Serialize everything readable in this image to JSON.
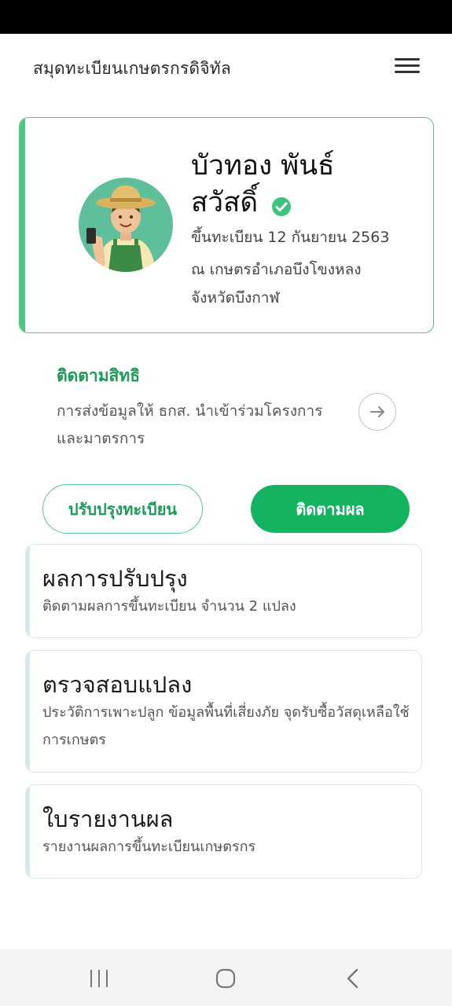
{
  "header": {
    "title": "สมุดทะเบียนเกษตรกรดิจิทัล",
    "menu_icon": "hamburger-menu-icon"
  },
  "profile": {
    "name_line1": "บัวทอง พันธ์",
    "name_line2": "สวัสดิ์",
    "verified_icon": "check-circle-icon",
    "registration_date": "ขึ้นทะเบียน 12 กันยายน 2563",
    "office": "ณ เกษตรอำเภอบึงโขงหลง",
    "province": "จังหวัดบึงกาฬ",
    "accent_color": "#4cc685"
  },
  "rights": {
    "title": "ติดตามสิทธิ",
    "description": "การส่งข้อมูลให้ ธกส. นำเข้าร่วมโครงการและมาตรการ",
    "arrow_icon": "arrow-right-icon"
  },
  "actions": {
    "update_label": "ปรับปรุงทะเบียน",
    "track_label": "ติดตามผล",
    "primary_color": "#14b362"
  },
  "cards": [
    {
      "title": "ผลการปรับปรุง",
      "description": "ติดตามผลการขึ้นทะเบียน จำนวน 2 แปลง"
    },
    {
      "title": "ตรวจสอบแปลง",
      "description": "ประวัติการเพาะปลูก ข้อมูลพื้นที่เสี่ยงภัย จุดรับซื้อวัสดุเหลือใช้การเกษตร"
    },
    {
      "title": "ใบรายงานผล",
      "description": "รายงานผลการขึ้นทะเบียนเกษตรกร"
    }
  ],
  "system_nav": {
    "recent_icon": "recent-apps-icon",
    "home_icon": "home-icon",
    "back_icon": "back-icon"
  }
}
